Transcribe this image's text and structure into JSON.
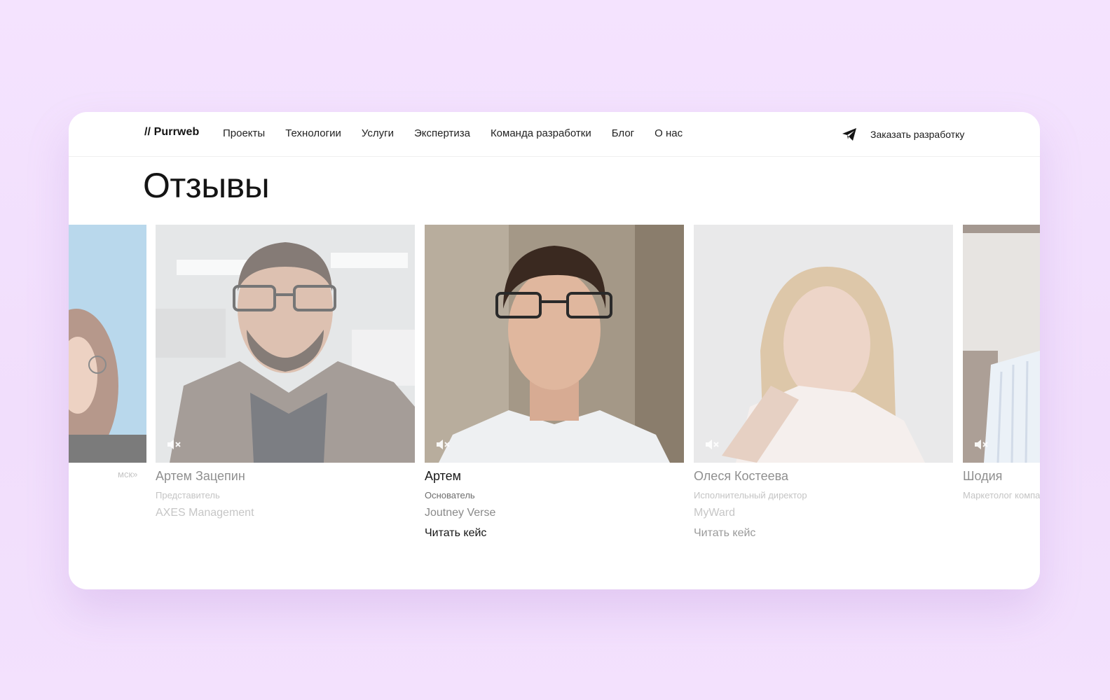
{
  "header": {
    "logo": "// Purrweb",
    "nav": [
      "Проекты",
      "Технологии",
      "Услуги",
      "Экспертиза",
      "Команда разработки",
      "Блог",
      "О нас"
    ],
    "cta_label": "Заказать разработку"
  },
  "section": {
    "title": "Отзывы"
  },
  "cards": [
    {
      "name": "",
      "role": "мск»",
      "company": ""
    },
    {
      "name": "Артем Зацепин",
      "role": "Представитель",
      "company": "AXES Management"
    },
    {
      "name": "Артем",
      "role": "Основатель",
      "company": "Joutney Verse",
      "link": "Читать кейс"
    },
    {
      "name": "Олеся Костеева",
      "role": "Исполнительный директор",
      "company": "MyWard",
      "link": "Читать кейс"
    },
    {
      "name": "Шодия",
      "role": "Маркетолог компа",
      "company": ""
    }
  ],
  "colors": {
    "page_bg": "#f3e2fd",
    "card_bg": "#ffffff",
    "text": "#141414"
  },
  "icons": {
    "cta": "paper-plane-icon",
    "video": "muted-speaker-icon"
  }
}
